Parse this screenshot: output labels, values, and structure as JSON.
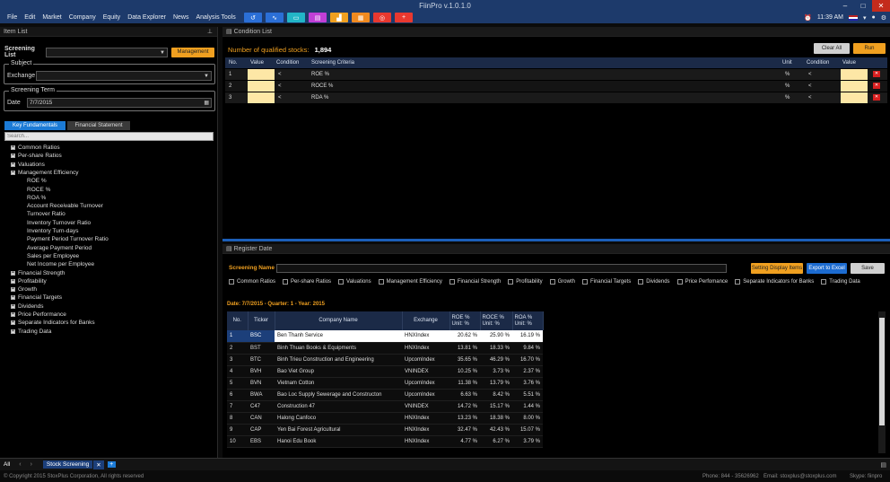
{
  "app": {
    "title": "FiinPro v.1.0.1.0"
  },
  "menu": [
    "File",
    "Edit",
    "Market",
    "Company",
    "Equity",
    "Data Explorer",
    "News",
    "Analysis Tools"
  ],
  "toolbar_icons": [
    {
      "name": "history-icon",
      "color": "#2b6fd6",
      "glyph": "↺"
    },
    {
      "name": "chart-icon",
      "color": "#2b6fd6",
      "glyph": "∿"
    },
    {
      "name": "screen-icon",
      "color": "#22b5c7",
      "glyph": "▭"
    },
    {
      "name": "doc-icon",
      "color": "#c03fd6",
      "glyph": "▤"
    },
    {
      "name": "industry-icon",
      "color": "#f0a020",
      "glyph": "▟"
    },
    {
      "name": "report-icon",
      "color": "#f08a20",
      "glyph": "▦"
    },
    {
      "name": "target-icon",
      "color": "#e8382f",
      "glyph": "◎"
    },
    {
      "name": "add-icon",
      "color": "#e8382f",
      "glyph": "+"
    }
  ],
  "clock": "11:39 AM",
  "item_list": {
    "title": "Item List",
    "screening_list_label": "Screening List",
    "management_label": "Management",
    "subject_title": "Subject",
    "exchange_label": "Exchange",
    "screening_term_title": "Screening Term",
    "date_label": "Date",
    "date_value": "7/7/2015",
    "tab_key": "Key Fundamentals",
    "tab_fs": "Financial Statement",
    "search_placeholder": "Search...",
    "tree_top": [
      "Common Ratios",
      "Per-share Ratios",
      "Valuations",
      "Management Efficiency"
    ],
    "tree_sub": [
      "ROE %",
      "ROCE %",
      "ROA %",
      "Account Receivable Turnover",
      "Turnover Ratio",
      "Inventory Turnover Ratio",
      "Inventory Turn-days",
      "Payment Period Turnover Ratio",
      "Average Payment Period",
      "Sales per Employee",
      "Net Income per Employee"
    ],
    "tree_bottom": [
      "Financial Strength",
      "Profitability",
      "Growth",
      "Financial Targets",
      "Dividends",
      "Price Performance",
      "Separate Indicators for Banks",
      "Trading Data"
    ]
  },
  "condition_list": {
    "title": "Condition List",
    "qualified_label": "Number of qualified stocks:",
    "qualified_count": "1,894",
    "clear_all": "Clear All",
    "run": "Run",
    "headers": [
      "No.",
      "Value",
      "Condition",
      "Screening Criteria",
      "Unit",
      "Condition",
      "Value"
    ],
    "rows": [
      {
        "no": "1",
        "cond": "<",
        "criteria": "ROE %",
        "unit": "%",
        "cond2": "<"
      },
      {
        "no": "2",
        "cond": "<",
        "criteria": "ROCE %",
        "unit": "%",
        "cond2": "<"
      },
      {
        "no": "3",
        "cond": "<",
        "criteria": "RDA %",
        "unit": "%",
        "cond2": "<"
      }
    ]
  },
  "register": {
    "title": "Register Date",
    "screening_name_label": "Screening Name",
    "setting_display": "Setting Display Items",
    "export": "Export to Excel",
    "save": "Save",
    "checks": [
      "Common Ratios",
      "Per-share Ratios",
      "Valuations",
      "Management Efficiency",
      "Financial Strength",
      "Profitability",
      "Growth",
      "Financial Targets",
      "Dividends",
      "Price Perfomance",
      "Separate Indicators for Banks",
      "Trading Data"
    ],
    "date_line": "Date: 7/7/2015 - Quarter: 1 - Year: 2015",
    "table_headers": {
      "no": "No.",
      "ticker": "Ticker",
      "name": "Company Name",
      "exchange": "Exchange",
      "roe": "ROE %",
      "roce": "ROCE %",
      "roa": "ROA %",
      "unit": "Unit: %"
    },
    "rows": [
      [
        "1",
        "BSC",
        "Ben Thanh Service",
        "HNXIndex",
        "20.62 %",
        "25.90 %",
        "16.19 %"
      ],
      [
        "2",
        "BST",
        "Binh Thuan Books & Equipments",
        "HNXIndex",
        "13.81 %",
        "18.33 %",
        "9.84 %"
      ],
      [
        "3",
        "BTC",
        "Binh Trieu Construction and Engineering",
        "UpcomIndex",
        "35.65 %",
        "46.29 %",
        "16.70 %"
      ],
      [
        "4",
        "BVH",
        "Bao Viet Group",
        "VNINDEX",
        "10.25 %",
        "3.73 %",
        "2.37 %"
      ],
      [
        "5",
        "BVN",
        "Vietnam Cotton",
        "UpcomIndex",
        "11.38 %",
        "13.79 %",
        "3.76 %"
      ],
      [
        "6",
        "BWA",
        "Bao Loc Supply Sewerage and Constructon",
        "UpcomIndex",
        "6.63 %",
        "8.42 %",
        "5.51 %"
      ],
      [
        "7",
        "C47",
        "Construction 47",
        "VNINDEX",
        "14.72 %",
        "15.17 %",
        "1.44 %"
      ],
      [
        "8",
        "CAN",
        "Halong Canfoco",
        "HNXIndex",
        "13.23 %",
        "18.38 %",
        "8.00 %"
      ],
      [
        "9",
        "CAP",
        "Yen Bai Forest Agricultural",
        "HNXIndex",
        "32.47 %",
        "42.43 %",
        "15.07 %"
      ],
      [
        "10",
        "EBS",
        "Hanoi Edu Book",
        "HNXIndex",
        "4.77 %",
        "6.27 %",
        "3.79 %"
      ]
    ]
  },
  "statusbar": {
    "all": "All",
    "tab": "Stock Screening"
  },
  "footer": {
    "copyright": "© Copyright 2015 StoxPlus Corporation, All rights reserved",
    "phone": "Phone: 844 - 35626962",
    "email": "Email: stoxplus@stoxplus.com",
    "skype": "Skype: fiinpro"
  }
}
